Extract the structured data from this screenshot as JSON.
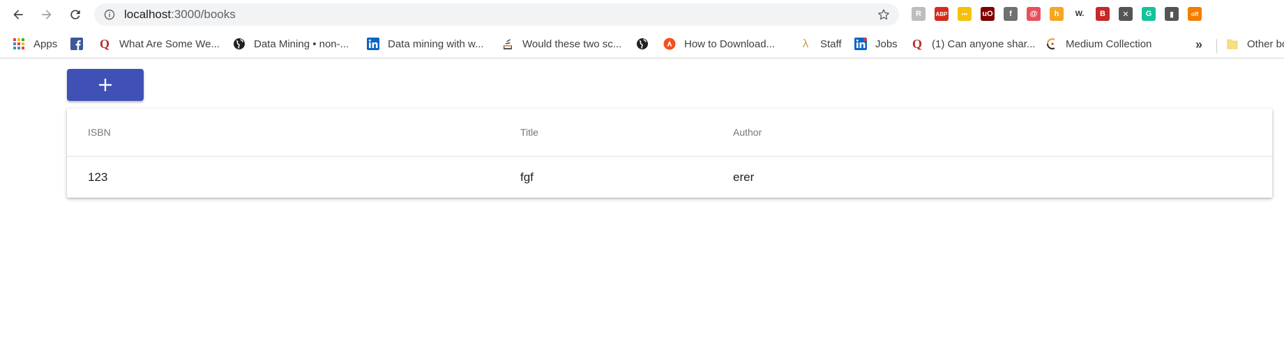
{
  "browser": {
    "url_host": "localhost",
    "url_path": ":3000/books",
    "extensions": [
      {
        "name": "reader-icon",
        "color": "#bdbdbd",
        "text": "R"
      },
      {
        "name": "adblock-plus-icon",
        "color": "#d52b1e",
        "text": "ABP"
      },
      {
        "name": "yellow-ext-icon",
        "color": "#f4c20d",
        "text": "•••"
      },
      {
        "name": "ublock-icon",
        "color": "#800000",
        "text": "uO"
      },
      {
        "name": "facebook-ext-icon",
        "color": "#707070",
        "text": "f"
      },
      {
        "name": "swirl-ext-icon",
        "color": "#e8505b",
        "text": "@"
      },
      {
        "name": "honey-ext-icon",
        "color": "#f5a623",
        "text": "h"
      },
      {
        "name": "wordtune-icon",
        "color": "#ffffff",
        "text": "W."
      },
      {
        "name": "book-ext-icon",
        "color": "#c62828",
        "text": "B"
      },
      {
        "name": "mail-ext-icon",
        "color": "#555555",
        "text": "✕"
      },
      {
        "name": "grammarly-icon",
        "color": "#15c39a",
        "text": "G"
      },
      {
        "name": "dark-ext-icon",
        "color": "#555555",
        "text": "▮"
      },
      {
        "name": "off-ext-icon",
        "color": "#f57c00",
        "text": "off"
      }
    ]
  },
  "bookmarks": {
    "items": [
      {
        "label": "Apps",
        "icon": "apps-grid-icon"
      },
      {
        "label": "",
        "icon": "facebook-icon"
      },
      {
        "label": "What Are Some We...",
        "icon": "quora-icon"
      },
      {
        "label": "Data Mining • non-...",
        "icon": "globe-icon"
      },
      {
        "label": "Data mining with w...",
        "icon": "linkedin-icon"
      },
      {
        "label": "Would these two sc...",
        "icon": "stackexchange-icon"
      },
      {
        "label": "",
        "icon": "globe-icon"
      },
      {
        "label": "How to Download...",
        "icon": "orange-circle-icon"
      },
      {
        "label": "Staff",
        "icon": "lambda-icon"
      },
      {
        "label": "Jobs",
        "icon": "linkedin-icon"
      },
      {
        "label": "(1) Can anyone shar...",
        "icon": "quora-icon"
      },
      {
        "label": "Medium Collection",
        "icon": "medium-icon"
      }
    ],
    "overflow": "»",
    "other_label": "Other bo"
  },
  "page": {
    "add_button_icon": "plus-icon",
    "table": {
      "headers": [
        "ISBN",
        "Title",
        "Author"
      ],
      "rows": [
        [
          "123",
          "fgf",
          "erer"
        ]
      ]
    }
  },
  "colors": {
    "primary": "#3f51b5"
  }
}
